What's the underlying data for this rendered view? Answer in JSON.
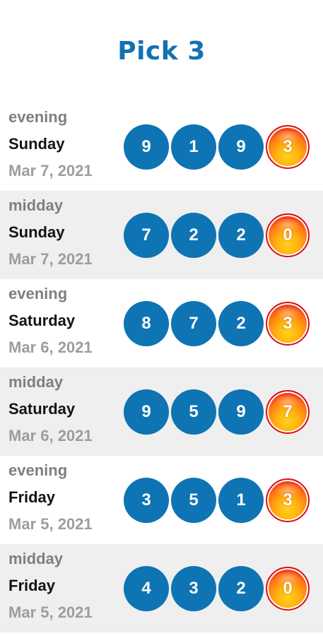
{
  "game": {
    "title": "Pick 3"
  },
  "draws": [
    {
      "draw": "evening",
      "day": "Sunday",
      "date": "Mar 7, 2021",
      "numbers": [
        "9",
        "1",
        "9"
      ],
      "fireball": "3"
    },
    {
      "draw": "midday",
      "day": "Sunday",
      "date": "Mar 7, 2021",
      "numbers": [
        "7",
        "2",
        "2"
      ],
      "fireball": "0"
    },
    {
      "draw": "evening",
      "day": "Saturday",
      "date": "Mar 6, 2021",
      "numbers": [
        "8",
        "7",
        "2"
      ],
      "fireball": "3"
    },
    {
      "draw": "midday",
      "day": "Saturday",
      "date": "Mar 6, 2021",
      "numbers": [
        "9",
        "5",
        "9"
      ],
      "fireball": "7"
    },
    {
      "draw": "evening",
      "day": "Friday",
      "date": "Mar 5, 2021",
      "numbers": [
        "3",
        "5",
        "1"
      ],
      "fireball": "3"
    },
    {
      "draw": "midday",
      "day": "Friday",
      "date": "Mar 5, 2021",
      "numbers": [
        "4",
        "3",
        "2"
      ],
      "fireball": "0"
    }
  ],
  "colors": {
    "title": "#1272b2",
    "ball": "#0e74b3",
    "fireball_outer": "#d9121c",
    "fireball_inner": "#ffd21a",
    "row_shade": "#efefef"
  },
  "icons": {
    "fireball": "fireball-icon"
  }
}
